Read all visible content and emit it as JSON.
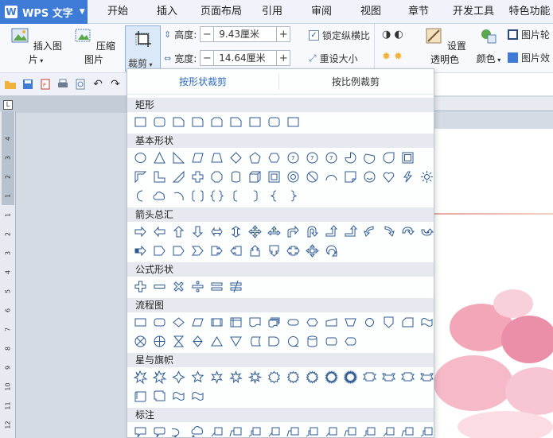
{
  "app": {
    "name": "WPS 文字",
    "logo": "W"
  },
  "menu_tabs": [
    "开始",
    "插入",
    "页面布局",
    "引用",
    "审阅",
    "视图",
    "章节",
    "开发工具",
    "特色功能"
  ],
  "ribbon": {
    "insert_picture": "插入图片",
    "compress_picture": "压缩图片",
    "crop": "裁剪",
    "height_label": "高度:",
    "height_value": "9.43厘米",
    "width_label": "宽度:",
    "width_value": "14.64厘米",
    "lock_ratio": "锁定纵横比",
    "reset_size": "重设大小",
    "set_transparent": "设置透明色",
    "color": "颜色",
    "picture_outline": "图片轮",
    "picture_effect": "图片效"
  },
  "crop_panel": {
    "tab_shape": "按形状裁剪",
    "tab_ratio": "按比例裁剪",
    "sections": {
      "rect": "矩形",
      "basic": "基本形状",
      "arrows": "箭头总汇",
      "formula": "公式形状",
      "flowchart": "流程图",
      "stars": "星与旗帜",
      "callouts": "标注"
    }
  },
  "ruler": {
    "vertical_numbers": [
      "4",
      "3",
      "2",
      "1",
      "1",
      "2",
      "3",
      "4",
      "5",
      "6",
      "7",
      "8",
      "9",
      "10",
      "11",
      "12",
      "13"
    ]
  },
  "colors": {
    "accent": "#3d7bd6",
    "tab_active": "#2e6bbf",
    "section_bg": "#e6eaf0",
    "shape_stroke": "#2c5a94"
  },
  "icons": [
    "insert-picture-icon",
    "compress-picture-icon",
    "crop-icon",
    "open-icon",
    "save-icon",
    "print-icon",
    "undo-icon",
    "redo-icon",
    "transparent-icon",
    "color-icon",
    "outline-icon",
    "effect-icon"
  ]
}
